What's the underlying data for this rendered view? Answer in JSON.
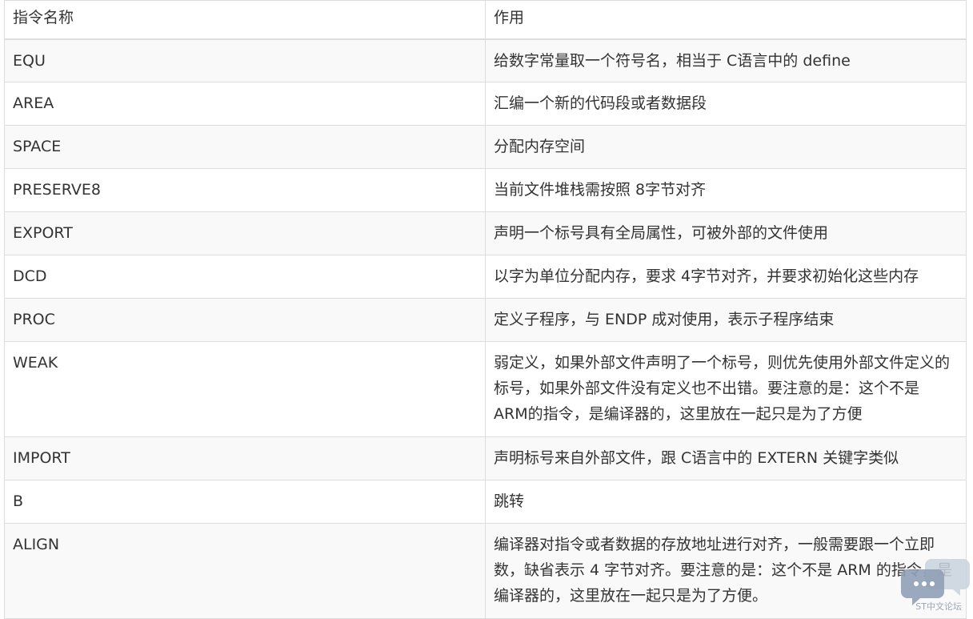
{
  "table": {
    "headers": [
      "指令名称",
      "作用"
    ],
    "rows": [
      {
        "name": "EQU",
        "desc": "给数字常量取一个符号名，相当于 C语言中的 define"
      },
      {
        "name": "AREA",
        "desc": "汇编一个新的代码段或者数据段"
      },
      {
        "name": "SPACE",
        "desc": "分配内存空间"
      },
      {
        "name": "PRESERVE8",
        "desc": "当前文件堆栈需按照 8字节对齐"
      },
      {
        "name": "EXPORT",
        "desc": "声明一个标号具有全局属性，可被外部的文件使用"
      },
      {
        "name": "DCD",
        "desc": "以字为单位分配内存，要求 4字节对齐，并要求初始化这些内存"
      },
      {
        "name": "PROC",
        "desc": "定义子程序，与 ENDP 成对使用，表示子程序结束"
      },
      {
        "name": "WEAK",
        "desc": "弱定义，如果外部文件声明了一个标号，则优先使用外部文件定义的标号，如果外部文件没有定义也不出错。要注意的是：这个不是 ARM的指令，是编译器的，这里放在一起只是为了方便"
      },
      {
        "name": "IMPORT",
        "desc": "声明标号来自外部文件，跟 C语言中的 EXTERN 关键字类似"
      },
      {
        "name": "B",
        "desc": "跳转"
      },
      {
        "name": "ALIGN",
        "desc": "编译器对指令或者数据的存放地址进行对齐，一般需要跟一个立即数，缺省表示 4 字节对齐。要注意的是：这个不是 ARM 的指令，是编译器的，这里放在一起只是为了方便。"
      }
    ]
  },
  "watermark": {
    "text": "ST中文论坛",
    "icon": "chat-bubble-icon",
    "color": "#9aa7b8"
  }
}
